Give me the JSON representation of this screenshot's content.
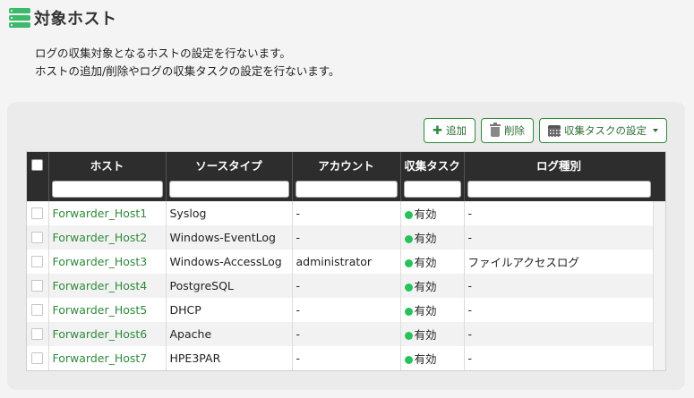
{
  "page": {
    "title": "対象ホスト",
    "description_line1": "ログの収集対象となるホストの設定を行ないます。",
    "description_line2": "ホストの追加/削除やログの収集タスクの設定を行ないます。",
    "title_icon": "list-icon"
  },
  "toolbar": {
    "add_label": "追加",
    "delete_label": "削除",
    "task_settings_label": "収集タスクの設定",
    "add_icon": "plus-icon",
    "delete_icon": "trash-icon",
    "task_icon": "calendar-icon"
  },
  "table": {
    "columns": [
      "ホスト",
      "ソースタイプ",
      "アカウント",
      "収集タスク",
      "ログ種別"
    ],
    "rows": [
      {
        "host": "Forwarder_Host1",
        "source_type": "Syslog",
        "account": "-",
        "task": "有効",
        "log_type": "-"
      },
      {
        "host": "Forwarder_Host2",
        "source_type": "Windows-EventLog",
        "account": "-",
        "task": "有効",
        "log_type": "-"
      },
      {
        "host": "Forwarder_Host3",
        "source_type": "Windows-AccessLog",
        "account": "administrator",
        "task": "有効",
        "log_type": "ファイルアクセスログ"
      },
      {
        "host": "Forwarder_Host4",
        "source_type": "PostgreSQL",
        "account": "-",
        "task": "有効",
        "log_type": "-"
      },
      {
        "host": "Forwarder_Host5",
        "source_type": "DHCP",
        "account": "-",
        "task": "有効",
        "log_type": "-"
      },
      {
        "host": "Forwarder_Host6",
        "source_type": "Apache",
        "account": "-",
        "task": "有効",
        "log_type": "-"
      },
      {
        "host": "Forwarder_Host7",
        "source_type": "HPE3PAR",
        "account": "-",
        "task": "有効",
        "log_type": "-"
      }
    ]
  },
  "colors": {
    "accent_green": "#2f8a3c",
    "status_dot": "#27c25b",
    "header_dark": "#2d2d2d"
  }
}
